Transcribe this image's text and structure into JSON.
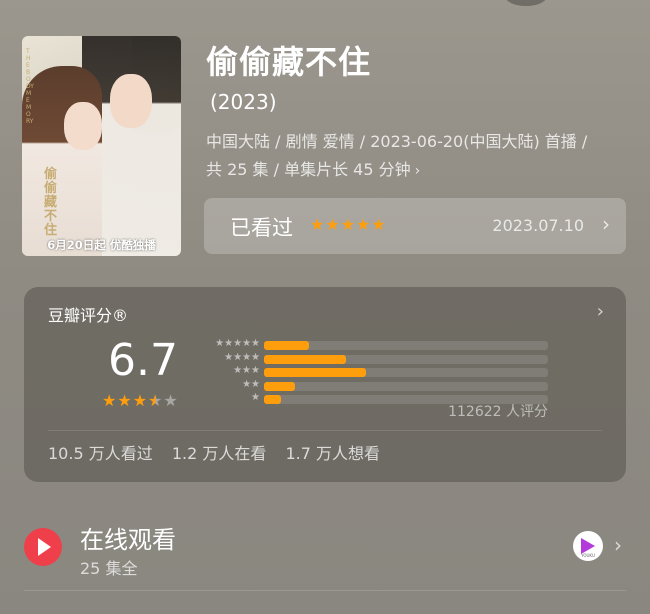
{
  "poster": {
    "caption": "6月20日起 优酷独播",
    "vertical_title": "偷偷藏不住",
    "vertical_small": "THE BODY MEMORY"
  },
  "show": {
    "title": "偷偷藏不住",
    "year": "(2023)",
    "meta_line1": "中国大陆 / 剧情 爱情 / 2023-06-20(中国大陆) 首播 /",
    "meta_line2": "共 25 集 / 单集片长 45 分钟",
    "meta_chevron": "›"
  },
  "watched": {
    "label": "已看过",
    "stars": "★★★★★",
    "date": "2023.07.10",
    "chevron": "›"
  },
  "rating": {
    "title": "豆瓣评分®",
    "chevron": "›",
    "score": "6.7",
    "stars_on": "★★★",
    "stars_half": "★",
    "stars_off": "★",
    "distribution": [
      {
        "stars": "★★★★★",
        "fraction": 0.16
      },
      {
        "stars": "★★★★",
        "fraction": 0.29
      },
      {
        "stars": "★★★",
        "fraction": 0.36
      },
      {
        "stars": "★★",
        "fraction": 0.11
      },
      {
        "stars": "★",
        "fraction": 0.06
      }
    ],
    "count": "112622 人评分",
    "stats": [
      "10.5 万人看过",
      "1.2 万人在看",
      "1.7 万人想看"
    ]
  },
  "online": {
    "title": "在线观看",
    "subtitle": "25 集全",
    "platform_icon": "youku-icon",
    "platform_text": "YOUKU",
    "chevron": "›"
  },
  "colors": {
    "accent": "#ff9e0d",
    "play_red": "#ef3f4a"
  }
}
